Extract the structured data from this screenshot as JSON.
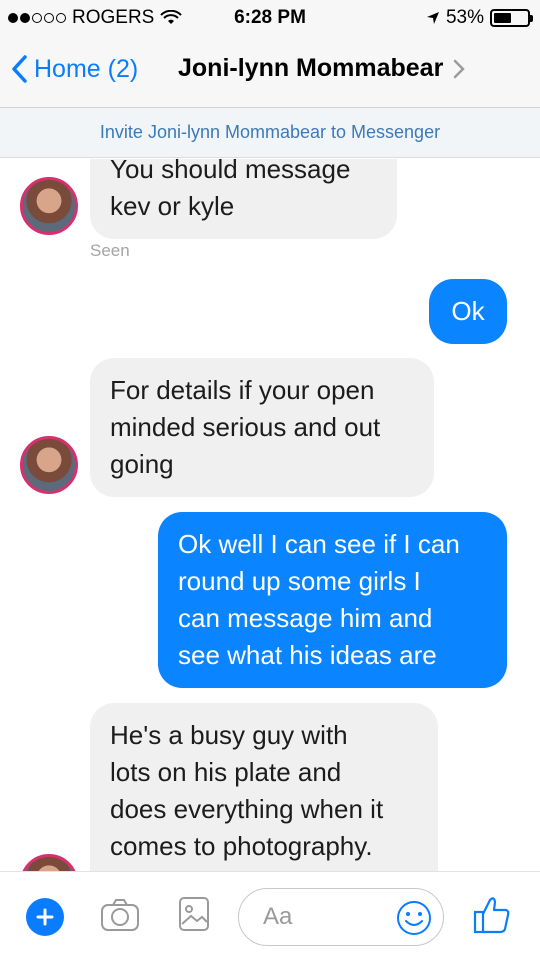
{
  "status_bar": {
    "carrier": "ROGERS",
    "time": "6:28 PM",
    "battery_percent": "53%",
    "battery_level": 0.53
  },
  "nav": {
    "back_label": "Home (2)",
    "title": "Joni-lynn Mommabear"
  },
  "invite": {
    "text": "Invite Joni-lynn Mommabear to Messenger"
  },
  "messages": [
    {
      "direction": "in",
      "lines": [
        "You should message",
        "kev or kyle"
      ]
    },
    {
      "direction": "out",
      "lines": [
        "Ok"
      ]
    },
    {
      "direction": "in",
      "lines": [
        "For details if your open",
        "minded serious and out",
        "going"
      ]
    },
    {
      "direction": "out",
      "lines": [
        "Ok well I can see if I can",
        "round up some girls I",
        "can message him and",
        "see what his ideas are"
      ]
    },
    {
      "direction": "in",
      "lines": [
        "He's a busy guy with",
        "lots on his plate and",
        "does everything when it",
        "comes to photography."
      ]
    }
  ],
  "seen_label": "Seen",
  "composer": {
    "placeholder": "Aa",
    "icons": [
      "plus-icon",
      "camera-icon",
      "image-icon",
      "emoji-icon",
      "thumbs-up-icon"
    ]
  },
  "colors": {
    "accent": "#0a7cff",
    "outgoing_bubble": "#0a84ff",
    "incoming_bubble": "#f1f0f0",
    "avatar_ring": "#d7306f"
  }
}
